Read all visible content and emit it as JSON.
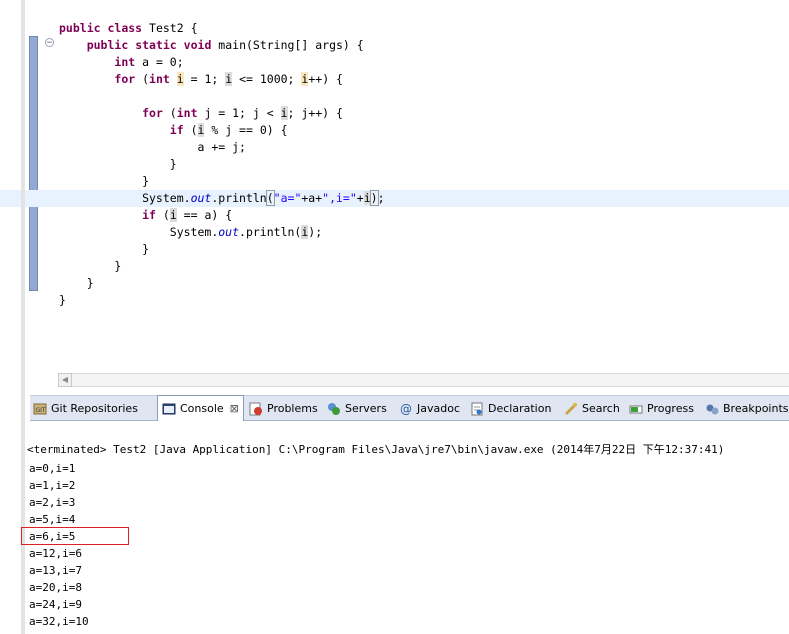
{
  "editor": {
    "code_lines": [
      {
        "tokens": [
          {
            "t": "kw",
            "v": "public"
          },
          {
            "t": "",
            "v": " "
          },
          {
            "t": "kw",
            "v": "class"
          },
          {
            "t": "",
            "v": " Test2 {"
          }
        ]
      },
      {
        "tokens": [
          {
            "t": "",
            "v": "    "
          },
          {
            "t": "kw",
            "v": "public"
          },
          {
            "t": "",
            "v": " "
          },
          {
            "t": "kw",
            "v": "static"
          },
          {
            "t": "",
            "v": " "
          },
          {
            "t": "kw",
            "v": "void"
          },
          {
            "t": "",
            "v": " main(String[] args) {"
          }
        ]
      },
      {
        "tokens": [
          {
            "t": "",
            "v": "        "
          },
          {
            "t": "kw",
            "v": "int"
          },
          {
            "t": "",
            "v": " a = 0;"
          }
        ]
      },
      {
        "tokens": [
          {
            "t": "",
            "v": "        "
          },
          {
            "t": "kw",
            "v": "for"
          },
          {
            "t": "",
            "v": " ("
          },
          {
            "t": "kw",
            "v": "int"
          },
          {
            "t": "",
            "v": " "
          },
          {
            "t": "occ-w",
            "v": "i"
          },
          {
            "t": "",
            "v": " = 1; "
          },
          {
            "t": "occ-r",
            "v": "i"
          },
          {
            "t": "",
            "v": " <= 1000; "
          },
          {
            "t": "occ-w",
            "v": "i"
          },
          {
            "t": "",
            "v": "++) {"
          }
        ]
      },
      {
        "tokens": [
          {
            "t": "",
            "v": ""
          }
        ]
      },
      {
        "tokens": [
          {
            "t": "",
            "v": "            "
          },
          {
            "t": "kw",
            "v": "for"
          },
          {
            "t": "",
            "v": " ("
          },
          {
            "t": "kw",
            "v": "int"
          },
          {
            "t": "",
            "v": " j = 1; j < "
          },
          {
            "t": "occ-r",
            "v": "i"
          },
          {
            "t": "",
            "v": "; j++) {"
          }
        ]
      },
      {
        "tokens": [
          {
            "t": "",
            "v": "                "
          },
          {
            "t": "kw",
            "v": "if"
          },
          {
            "t": "",
            "v": " ("
          },
          {
            "t": "occ-r",
            "v": "i"
          },
          {
            "t": "",
            "v": " % j == 0) {"
          }
        ]
      },
      {
        "tokens": [
          {
            "t": "",
            "v": "                    a += j;"
          }
        ]
      },
      {
        "tokens": [
          {
            "t": "",
            "v": "                }"
          }
        ]
      },
      {
        "tokens": [
          {
            "t": "",
            "v": "            }"
          }
        ]
      },
      {
        "hl": true,
        "tokens": [
          {
            "t": "",
            "v": "            System."
          },
          {
            "t": "fld",
            "v": "out"
          },
          {
            "t": "",
            "v": ".println"
          },
          {
            "t": "bracket",
            "v": "("
          },
          {
            "t": "str",
            "v": "\"a=\""
          },
          {
            "t": "",
            "v": "+a+"
          },
          {
            "t": "str",
            "v": "\",i=\""
          },
          {
            "t": "",
            "v": "+"
          },
          {
            "t": "occ-r",
            "v": "i"
          },
          {
            "t": "bracket",
            "v": ")"
          },
          {
            "t": "",
            "v": ";"
          }
        ]
      },
      {
        "tokens": [
          {
            "t": "",
            "v": "            "
          },
          {
            "t": "kw",
            "v": "if"
          },
          {
            "t": "",
            "v": " ("
          },
          {
            "t": "occ-r",
            "v": "i"
          },
          {
            "t": "",
            "v": " == a) {"
          }
        ]
      },
      {
        "tokens": [
          {
            "t": "",
            "v": "                System."
          },
          {
            "t": "fld",
            "v": "out"
          },
          {
            "t": "",
            "v": ".println("
          },
          {
            "t": "occ-r",
            "v": "i"
          },
          {
            "t": "",
            "v": ");"
          }
        ]
      },
      {
        "tokens": [
          {
            "t": "",
            "v": "            }"
          }
        ]
      },
      {
        "tokens": [
          {
            "t": "",
            "v": "        }"
          }
        ]
      },
      {
        "tokens": [
          {
            "t": "",
            "v": "    }"
          }
        ]
      },
      {
        "tokens": [
          {
            "t": "",
            "v": "}"
          }
        ]
      }
    ]
  },
  "tabs": {
    "git": "Git Repositories",
    "console": "Console",
    "problems": "Problems",
    "servers": "Servers",
    "javadoc": "Javadoc",
    "declaration": "Declaration",
    "search": "Search",
    "progress": "Progress",
    "breakpoints": "Breakpoints"
  },
  "console": {
    "header": "<terminated> Test2 [Java Application] C:\\Program Files\\Java\\jre7\\bin\\javaw.exe (2014年7月22日 下午12:37:41)",
    "output": [
      "a=0,i=1",
      "a=1,i=2",
      "a=2,i=3",
      "a=5,i=4",
      "a=6,i=5",
      "a=12,i=6",
      "a=13,i=7",
      "a=20,i=8",
      "a=24,i=9",
      "a=32,i=10"
    ]
  }
}
